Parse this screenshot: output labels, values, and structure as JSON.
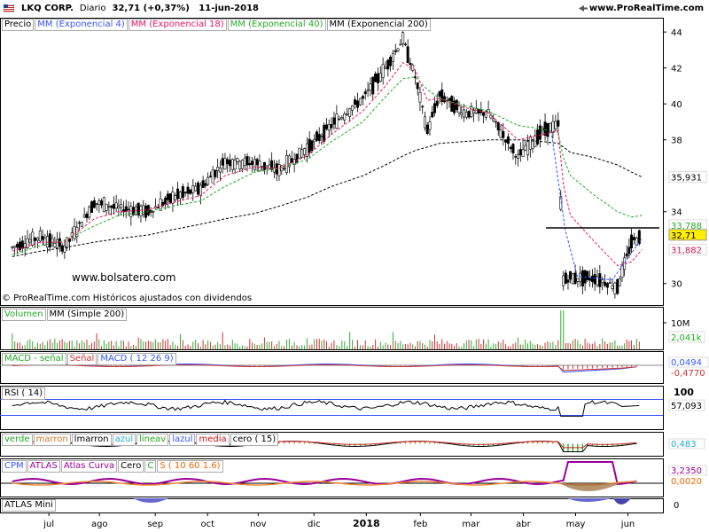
{
  "header": {
    "symbol": "LKQ CORP.",
    "period": "Diario",
    "price_change": "32,71 (+0,37%)",
    "date": "11-jun-2018",
    "site": "www.ProRealTime.com"
  },
  "price_panel": {
    "legend": [
      "Precio",
      "MM (Exponencial 4)",
      "MM (Exponencial 18)",
      "MM (Exponencial 40)",
      "MM (Exponencial 200)"
    ],
    "legend_colors": [
      "#000000",
      "#3355ff",
      "#ee1166",
      "#22aa22",
      "#000000"
    ],
    "watermark": "www.bolsatero.com",
    "copyright": "© ProRealTime.com  Históricos ajustados con dividendos",
    "yticks": [
      "44",
      "42",
      "40",
      "38",
      "34",
      "30"
    ],
    "last_labels": {
      "ema200": "35,931",
      "ema40": "33,788",
      "price": "32,71",
      "ema18": "31,882"
    }
  },
  "volume_panel": {
    "legend": [
      "Volumen",
      "MM (Simple 200)"
    ],
    "ytick": "10M",
    "last": "2,041k"
  },
  "macd_panel": {
    "legend": [
      "MACD - señal",
      "Señal",
      "MACD ( 12 26 9)"
    ],
    "last": [
      "0,0494",
      "-0,4770"
    ]
  },
  "rsi_panel": {
    "legend": "RSI ( 14)",
    "ytick": "100",
    "last": "57,093"
  },
  "lineas_panel": {
    "legend": [
      "verde",
      "marron",
      "lmarron",
      "azul",
      "lineav",
      "lazul",
      "media",
      "cero ( 15)"
    ],
    "last": "0,483"
  },
  "cpm_panel": {
    "legend": [
      "CPM",
      "ATLAS",
      "Atlas Curva",
      "Cero",
      "C",
      "S ( 10 60 1.6)"
    ],
    "last": [
      "3,2350",
      "0,0020"
    ]
  },
  "atlas_panel": {
    "legend": "ATLAS Mini",
    "ytick": "0"
  },
  "x_axis": [
    "jul",
    "ago",
    "sep",
    "oct",
    "nov",
    "dic",
    "2018",
    "feb",
    "mar",
    "abr",
    "may",
    "jun"
  ],
  "chart_data": {
    "type": "line",
    "title": "LKQ CORP. Diario",
    "x": [
      "2017-06-15",
      "2017-07-01",
      "2017-07-15",
      "2017-08-01",
      "2017-08-15",
      "2017-09-01",
      "2017-09-15",
      "2017-10-01",
      "2017-10-15",
      "2017-11-01",
      "2017-11-15",
      "2017-12-01",
      "2017-12-15",
      "2018-01-02",
      "2018-01-15",
      "2018-01-25",
      "2018-02-01",
      "2018-02-08",
      "2018-02-15",
      "2018-03-01",
      "2018-03-15",
      "2018-04-01",
      "2018-04-15",
      "2018-04-24",
      "2018-04-27",
      "2018-05-01",
      "2018-05-15",
      "2018-05-28",
      "2018-06-05",
      "2018-06-11"
    ],
    "series": [
      {
        "name": "Precio",
        "values": [
          32.0,
          32.6,
          32.0,
          34.5,
          34.2,
          34.0,
          34.8,
          35.3,
          36.8,
          36.7,
          36.3,
          37.5,
          38.8,
          40.3,
          42.0,
          43.6,
          41.5,
          38.5,
          40.5,
          39.5,
          39.5,
          37.0,
          38.5,
          38.8,
          30.2,
          30.3,
          30.3,
          29.8,
          32.3,
          32.71
        ]
      },
      {
        "name": "MM (Exponencial 200)",
        "values": [
          31.5,
          31.8,
          32.0,
          32.3,
          32.5,
          32.7,
          33.0,
          33.3,
          33.6,
          33.9,
          34.3,
          34.8,
          35.4,
          36.0,
          36.6,
          37.1,
          37.4,
          37.6,
          37.8,
          37.9,
          38.0,
          38.0,
          37.9,
          37.8,
          37.6,
          37.3,
          37.0,
          36.6,
          36.2,
          35.931
        ]
      },
      {
        "name": "MM (Exponencial 40)",
        "values": [
          31.6,
          32.1,
          32.4,
          33.2,
          33.8,
          34.0,
          34.3,
          34.6,
          35.4,
          36.2,
          36.4,
          36.9,
          37.9,
          39.0,
          40.4,
          41.4,
          41.5,
          40.8,
          40.3,
          39.9,
          39.6,
          38.8,
          38.6,
          38.4,
          37.0,
          36.0,
          34.9,
          34.0,
          33.7,
          33.788
        ]
      },
      {
        "name": "MM (Exponencial 18)",
        "values": [
          31.8,
          32.3,
          32.3,
          33.6,
          34.0,
          34.1,
          34.5,
          34.9,
          36.0,
          36.5,
          36.4,
          37.1,
          38.3,
          39.6,
          41.0,
          42.3,
          41.9,
          40.2,
          40.3,
          39.8,
          39.5,
          38.0,
          38.3,
          38.5,
          35.5,
          33.8,
          32.3,
          31.0,
          31.2,
          31.882
        ]
      }
    ],
    "ylabel": "",
    "ylim": [
      29,
      44.5
    ]
  }
}
